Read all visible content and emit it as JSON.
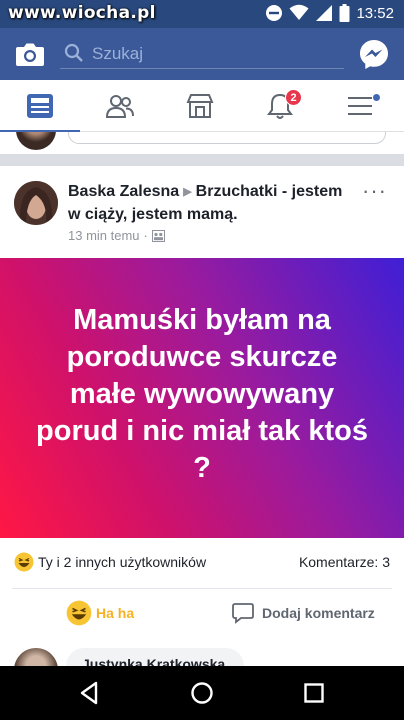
{
  "status_bar": {
    "watermark": "www.wiocha.pl",
    "time": "13:52"
  },
  "header": {
    "search_placeholder": "Szukaj",
    "camera_icon": "camera-icon",
    "messenger_icon": "messenger-icon"
  },
  "tabs": [
    {
      "icon": "news-feed-icon",
      "active": true
    },
    {
      "icon": "friends-icon"
    },
    {
      "icon": "marketplace-icon"
    },
    {
      "icon": "notifications-icon",
      "badge": "2"
    },
    {
      "icon": "menu-icon",
      "dot": true
    }
  ],
  "post": {
    "author": "Baska Zalesna",
    "group": "Brzuchatki - jestem w ciąży, jestem mamą.",
    "time": "13 min temu",
    "more_label": "···",
    "text": "Mamuśki byłam na poroduwce skurcze małe wywowywany porud i nic miał tak ktoś ?",
    "banner_colors": [
      "#ff1744",
      "#d0116a",
      "#9a1b9e",
      "#3f1fd6"
    ],
    "reactions_text": "Ty i 2 innych użytkowników",
    "comments_count": "Komentarze: 3",
    "action_react": "Ha ha",
    "action_comment": "Dodaj komentarz"
  },
  "comment_preview": {
    "author": "Justynka Kratkowska"
  },
  "colors": {
    "brand": "#3b5998",
    "status": "#29487d",
    "haha": "#f7b125",
    "badge": "#e8374c"
  }
}
